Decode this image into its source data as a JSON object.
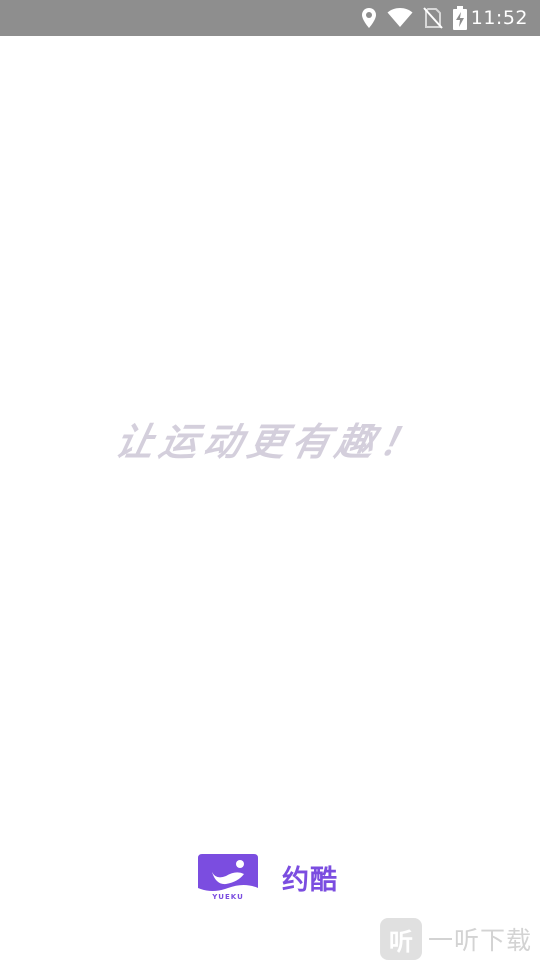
{
  "status_bar": {
    "time": "11:52",
    "icons": [
      "location-icon",
      "wifi-icon",
      "no-sim-icon",
      "battery-charging-icon"
    ]
  },
  "splash": {
    "slogan": "让运动更有趣！"
  },
  "brand": {
    "logo_text": "YUEKU",
    "name": "约酷",
    "accent_color": "#7b4de0"
  },
  "watermark": {
    "badge": "听",
    "text": "一听下载"
  }
}
